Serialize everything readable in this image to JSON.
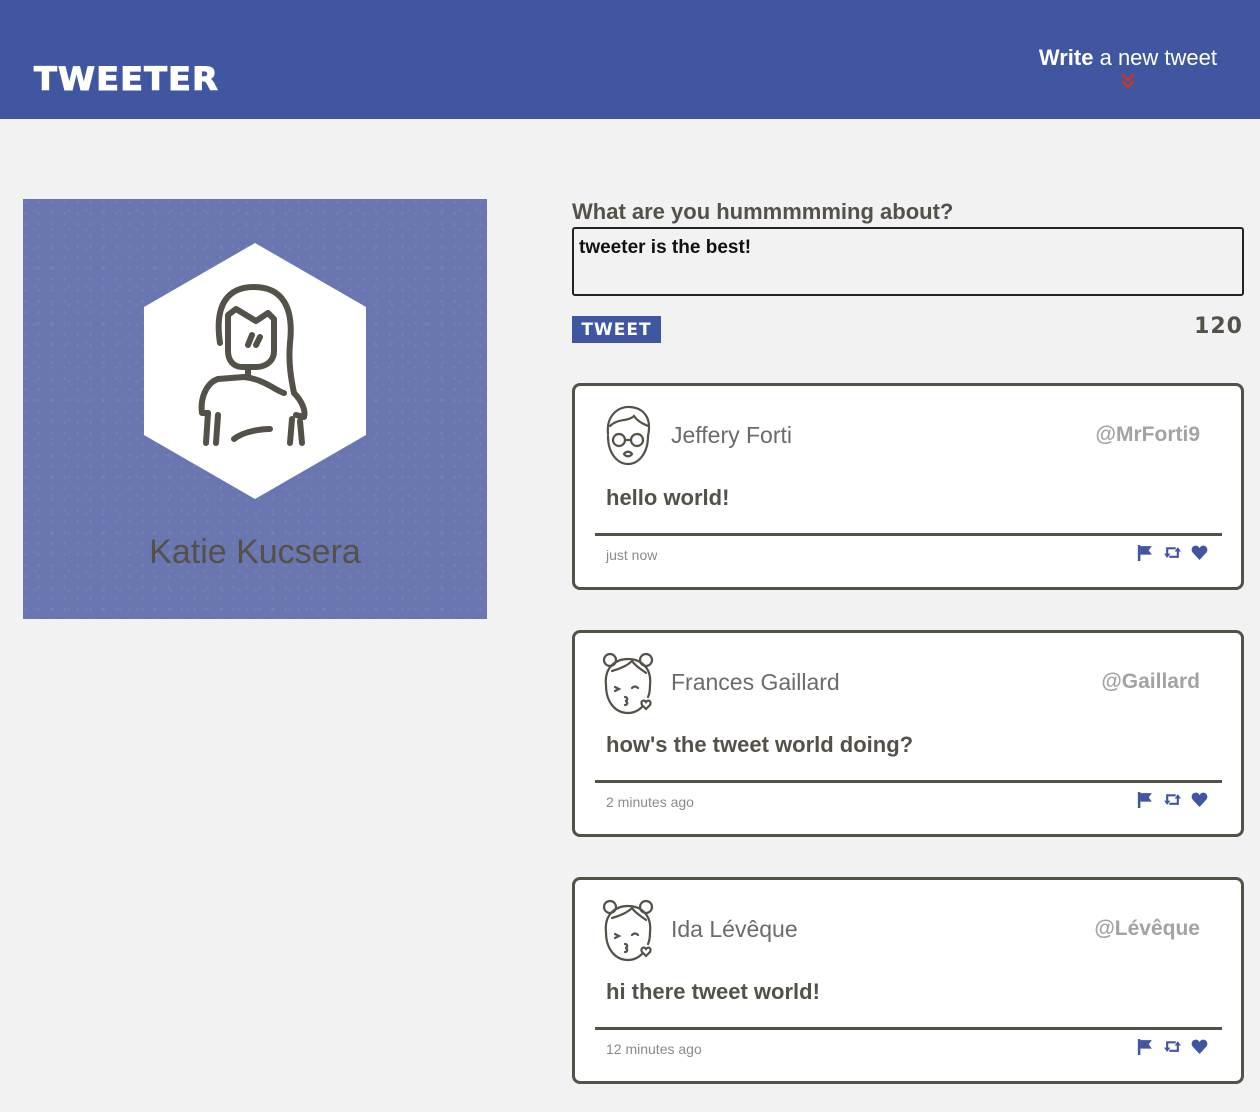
{
  "nav": {
    "brand": "TWEETER",
    "compose_bold": "Write",
    "compose_rest": " a new tweet",
    "compose_icon": "double-chevron-down-icon",
    "compose_icon_color": "#c0392b"
  },
  "colors": {
    "primary": "#4056a1",
    "profile_bg": "#6a76b0",
    "text": "#545149",
    "page_bg": "#f2f2f2"
  },
  "profile": {
    "name": "Katie Kucsera",
    "avatar_icon": "woman-avatar-icon"
  },
  "composer": {
    "label": "What are you hummmmming about?",
    "value": "tweeter is the best!",
    "button": "TWEET",
    "counter": "120"
  },
  "tweets": [
    {
      "name": "Jeffery Forti",
      "handle": "@MrForti9",
      "text": "hello world!",
      "time": "just now",
      "avatar_icon": "man-glasses-avatar-icon"
    },
    {
      "name": "Frances Gaillard",
      "handle": "@Gaillard",
      "text": "how's the tweet world doing?",
      "time": "2 minutes ago",
      "avatar_icon": "girl-kiss-avatar-icon"
    },
    {
      "name": "Ida Lévêque",
      "handle": "@Lévêque",
      "text": "hi there tweet world!",
      "time": "12 minutes ago",
      "avatar_icon": "girl-kiss-avatar-icon"
    }
  ],
  "action_icons": [
    "flag-icon",
    "retweet-icon",
    "heart-icon"
  ]
}
